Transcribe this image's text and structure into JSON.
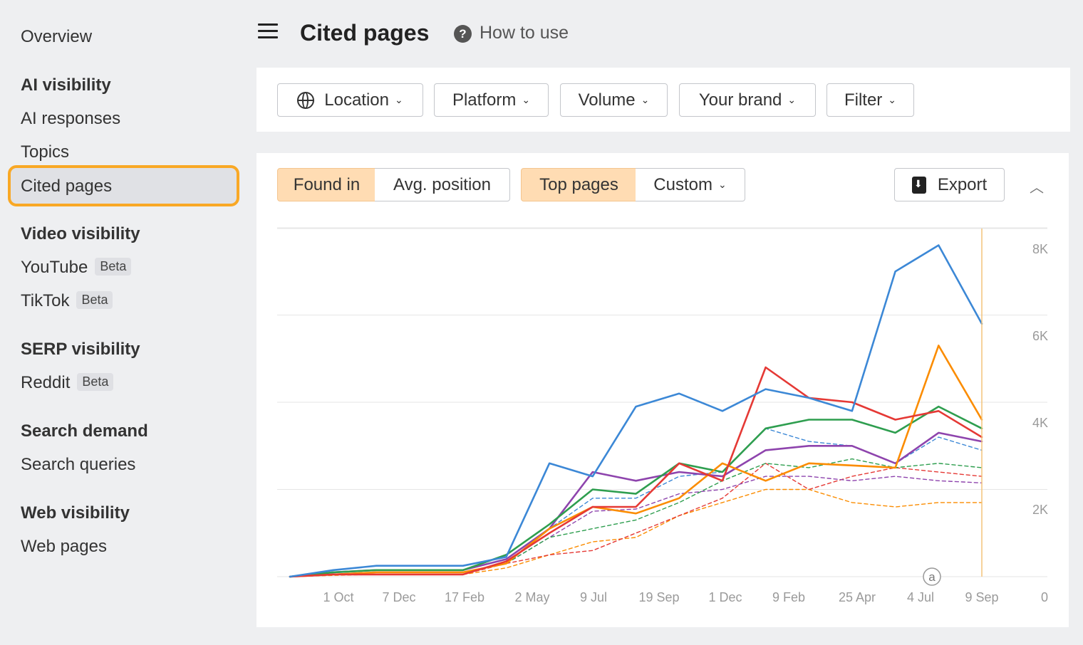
{
  "sidebar": {
    "overview": "Overview",
    "sections": [
      {
        "title": "AI visibility",
        "items": [
          "AI responses",
          "Topics",
          "Cited pages"
        ]
      },
      {
        "title": "Video visibility",
        "items": [
          "YouTube",
          "TikTok"
        ]
      },
      {
        "title": "SERP visibility",
        "items": [
          "Reddit"
        ]
      },
      {
        "title": "Search demand",
        "items": [
          "Search queries"
        ]
      },
      {
        "title": "Web visibility",
        "items": [
          "Web pages"
        ]
      }
    ],
    "beta_label": "Beta",
    "active_item": "Cited pages"
  },
  "header": {
    "title": "Cited pages",
    "help_icon": "?",
    "help_text": "How to use"
  },
  "filters": {
    "location": "Location",
    "platform": "Platform",
    "volume": "Volume",
    "your_brand": "Your brand",
    "filter": "Filter"
  },
  "chart_controls": {
    "found_in": "Found in",
    "avg_position": "Avg. position",
    "top_pages": "Top pages",
    "custom": "Custom",
    "export": "Export"
  },
  "colors": {
    "accent_orange": "#f9a825",
    "selected_bg": "#ffdcb3",
    "blue": "#3c88d6",
    "orange": "#fb8c00",
    "green": "#2e9e4f",
    "red": "#e53935",
    "purple": "#8e44ad"
  },
  "chart_data": {
    "type": "line",
    "annotation_marker": "a",
    "x_tick_labels": [
      "1 Oct",
      "7 Dec",
      "17 Feb",
      "2 May",
      "9 Jul",
      "19 Sep",
      "1 Dec",
      "9 Feb",
      "25 Apr",
      "4 Jul",
      "9 Sep"
    ],
    "y_tick_labels": [
      "8K",
      "6K",
      "4K",
      "2K",
      "0"
    ],
    "ylim": [
      0,
      8000
    ],
    "y_axis_position": "right",
    "grid": true,
    "legend": "none",
    "series": [
      {
        "color": "#3c88d6",
        "style": "solid",
        "values": [
          0,
          150,
          250,
          250,
          250,
          450,
          2600,
          2300,
          3900,
          4200,
          3800,
          4300,
          4100,
          3800,
          7000,
          7600,
          5800
        ]
      },
      {
        "color": "#fb8c00",
        "style": "solid",
        "values": [
          0,
          50,
          100,
          100,
          100,
          300,
          1100,
          1600,
          1450,
          1800,
          2600,
          2200,
          2600,
          2550,
          2500,
          5300,
          3600
        ]
      },
      {
        "color": "#2e9e4f",
        "style": "solid",
        "values": [
          0,
          100,
          150,
          150,
          150,
          500,
          1200,
          2000,
          1900,
          2600,
          2400,
          3400,
          3600,
          3600,
          3300,
          3900,
          3400
        ]
      },
      {
        "color": "#e53935",
        "style": "solid",
        "values": [
          0,
          50,
          50,
          50,
          50,
          350,
          1000,
          1600,
          1600,
          2600,
          2200,
          4800,
          4100,
          4000,
          3600,
          3800,
          3200
        ]
      },
      {
        "color": "#8e44ad",
        "style": "solid",
        "values": [
          0,
          100,
          150,
          150,
          150,
          400,
          1100,
          2400,
          2200,
          2400,
          2300,
          2900,
          3000,
          3000,
          2600,
          3300,
          3100
        ]
      },
      {
        "color": "#3c88d6",
        "style": "dashed",
        "values": [
          0,
          100,
          150,
          150,
          150,
          400,
          1100,
          1800,
          1800,
          2300,
          2400,
          3400,
          3100,
          3000,
          2600,
          3200,
          2900
        ]
      },
      {
        "color": "#2e9e4f",
        "style": "dashed",
        "values": [
          0,
          50,
          100,
          100,
          100,
          300,
          900,
          1100,
          1300,
          1700,
          2200,
          2600,
          2500,
          2700,
          2500,
          2600,
          2500
        ]
      },
      {
        "color": "#8e44ad",
        "style": "dashed",
        "values": [
          0,
          50,
          100,
          100,
          100,
          300,
          900,
          1500,
          1550,
          1900,
          2000,
          2300,
          2300,
          2200,
          2300,
          2200,
          2150
        ]
      },
      {
        "color": "#e53935",
        "style": "dashed",
        "values": [
          0,
          50,
          50,
          50,
          50,
          300,
          500,
          600,
          1000,
          1400,
          1800,
          2600,
          2000,
          2300,
          2500,
          2400,
          2300
        ]
      },
      {
        "color": "#fb8c00",
        "style": "dashed",
        "values": [
          0,
          30,
          50,
          50,
          50,
          200,
          500,
          800,
          900,
          1400,
          1700,
          2000,
          2000,
          1700,
          1600,
          1700,
          1700
        ]
      }
    ]
  }
}
